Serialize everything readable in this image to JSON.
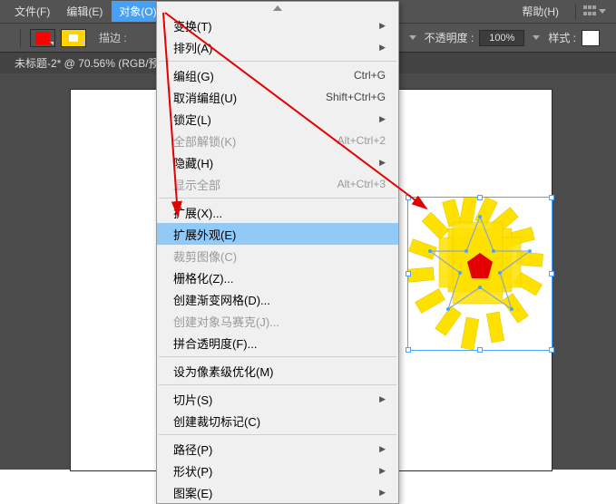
{
  "menubar": {
    "file": "文件(F)",
    "edit": "编辑(E)",
    "object": "对象(O)",
    "help": "帮助(H)"
  },
  "toolbar": {
    "stroke_label": "描边 :",
    "opacity_label": "不透明度 :",
    "opacity_value": "100%",
    "style_label": "样式 :",
    "fill_color": "#ff0000",
    "stroke_swatch_bg": "#ffd400",
    "stroke_swatch_inner": "#ffffff"
  },
  "tab": {
    "title": "未标题-2* @ 70.56% (RGB/预览)"
  },
  "menu": {
    "transform": "变换(T)",
    "arrange": "排列(A)",
    "group": "编组(G)",
    "group_sc": "Ctrl+G",
    "ungroup": "取消编组(U)",
    "ungroup_sc": "Shift+Ctrl+G",
    "lock": "锁定(L)",
    "unlock_all": "全部解锁(K)",
    "unlock_all_sc": "Alt+Ctrl+2",
    "hide": "隐藏(H)",
    "show_all": "显示全部",
    "show_all_sc": "Alt+Ctrl+3",
    "expand": "扩展(X)...",
    "expand_appearance": "扩展外观(E)",
    "crop_image": "裁剪图像(C)",
    "rasterize": "栅格化(Z)...",
    "gradient_mesh": "创建渐变网格(D)...",
    "mosaic": "创建对象马赛克(J)...",
    "flatten": "拼合透明度(F)...",
    "pixel_perfect": "设为像素级优化(M)",
    "slice": "切片(S)",
    "trim_marks": "创建裁切标记(C)",
    "path": "路径(P)",
    "shape": "形状(P)",
    "pattern": "图案(E)"
  }
}
